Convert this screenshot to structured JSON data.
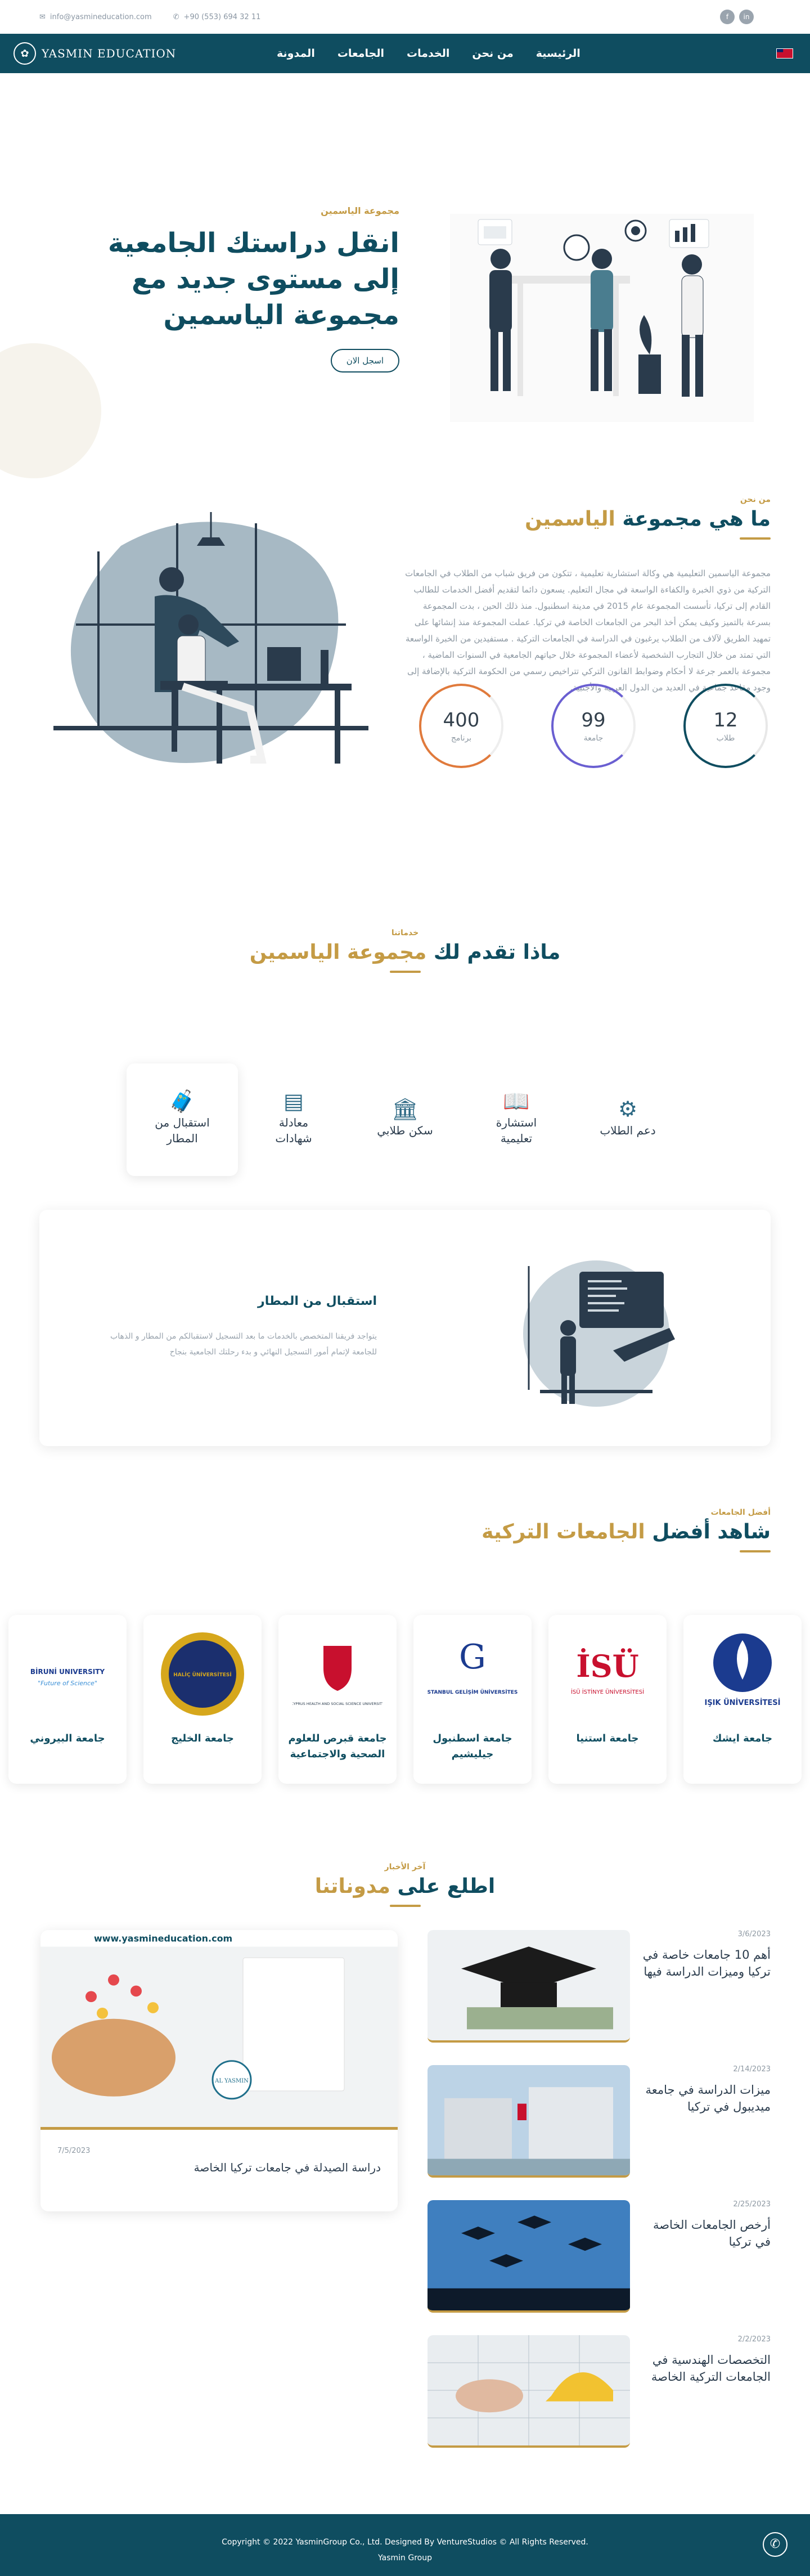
{
  "topbar": {
    "email": "info@yasmineducation.com",
    "phone": "+90 (553) 694 32 11",
    "social": [
      "f",
      "in"
    ]
  },
  "nav": {
    "logo": "YASMIN EDUCATION",
    "menu": [
      "الرئيسية",
      "من نحن",
      "الخدمات",
      "الجامعات",
      "المدونة"
    ]
  },
  "hero": {
    "eyebrow": "مجموعة الياسمين",
    "title": "انقل دراستك الجامعية إلى مستوى جديد مع مجموعة الياسمين",
    "button": "اسجل الان"
  },
  "about": {
    "eyebrow": "من نحن",
    "title_main": "ما هي مجموعة ",
    "title_gold": "الياسمين",
    "paragraph": "مجموعة الياسمين التعليمية هي وكالة استشارية تعليمية ، تتكون من فريق شباب من الطلاب في الجامعات التركية من ذوي الخبرة والكفاءة الواسعة في مجال التعليم. يسعون دائما لتقديم أفضل الخدمات للطالب القادم إلى تركيا، تأسست المجموعة عام 2015 في مدينة اسطنبول. منذ ذلك الحين ، بدت المجموعة بسرعة بالتميز وكيف يمكن أخذ البحر من الجامعات الخاصة في تركيا. عملت المجموعة منذ إنشائها على تمهيد الطريق لآلاف من الطلاب يرغبون في الدراسة في الجامعات التركية . مستفيدين من الخبرة الواسعة التي تمتد من خلال التجارب الشخصية لأعضاء المجموعة خلال حياتهم الجامعية في السنوات الماضية ، مجموعة بالعمر جرعة لا أحكام وضوابط القانون التركي تتراخيص رسمي من الحكومة التركية بالإضافة إلى وجود مقاعد جماعية في العديد من الدول العربية والأجنبية.",
    "stats": [
      {
        "num": "400",
        "label": "برنامج"
      },
      {
        "num": "99",
        "label": "جامعة"
      },
      {
        "num": "12",
        "label": "طلاب"
      }
    ]
  },
  "services": {
    "eyebrow": "خدماتنا",
    "title_main": "ماذا تقدم لك ",
    "title_gold": "مجموعة الياسمين",
    "cards": [
      {
        "icon": "airport-icon",
        "label": "استقبال من المطار"
      },
      {
        "icon": "certificate-icon",
        "label": "معادلة شهادات"
      },
      {
        "icon": "dorm-icon",
        "label": "سكن طلابي"
      },
      {
        "icon": "book-icon",
        "label": "استشارة تعليمية"
      },
      {
        "icon": "support-icon",
        "label": "دعم الطلاب"
      }
    ],
    "detail_title": "استقبال من المطار",
    "detail_text": "يتواجد فريقنا المتخصص بالخدمات ما بعد التسجيل لاستقبالكم من المطار و الذهاب للجامعة لإتمام أمور التسجيل النهائي و بدء رحلتك الجامعية بنجاح"
  },
  "unis": {
    "eyebrow": "أفضل الجامعات",
    "title_main": "شاهد أفضل ",
    "title_gold": "الجامعات التركية",
    "cards": [
      {
        "logo": "IŞIK ÜNİVERSİTESİ",
        "name": "جامعة ايشك"
      },
      {
        "logo": "İSÜ İSTİNYE ÜNİVERSİTESİ",
        "name": "جامعة استنيا"
      },
      {
        "logo": "İSTANBUL GELİŞİM ÜNİVERSİTESİ",
        "name": "جامعة اسطنبول جيليشيم"
      },
      {
        "logo": "CYPRUS HEALTH AND SOCIAL SCIENCE UNIVERSITY",
        "name": "جامعة قبرص للعلوم الصحية والاجتماعية"
      },
      {
        "logo": "HALİÇ ÜNİVERSİTESİ",
        "name": "جامعة الخليج"
      },
      {
        "logo": "BİRUNİ UNIVERSITY",
        "logo_sub": "\"Future of Science\"",
        "name": "جامعة البيروني"
      }
    ]
  },
  "blog": {
    "eyebrow": "آخر الأخبار",
    "title_main": "اطلع على ",
    "title_gold": "مدوناتنا",
    "big": {
      "date": "7/5/2023",
      "title": "دراسة الصيدلة في جامعات تركيا الخاصة",
      "site": "www.yasmineducation.com"
    },
    "posts": [
      {
        "date": "3/6/2023",
        "title": "أهم 10 جامعات خاصة في تركيا وميزات الدراسة فيها"
      },
      {
        "date": "2/14/2023",
        "title": "ميزات الدراسة في جامعة ميديبول في تركيا"
      },
      {
        "date": "2/25/2023",
        "title": "أرخص الجامعات الخاصة في تركيا"
      },
      {
        "date": "2/2/2023",
        "title": "التخصصات الهندسية في الجامعات التركية الخاصة"
      }
    ]
  },
  "footer": {
    "copyright": "Copyright © 2022 YasminGroup Co., Ltd. Designed By VentureStudios © All Rights Reserved.",
    "brand": "Yasmin Group"
  }
}
